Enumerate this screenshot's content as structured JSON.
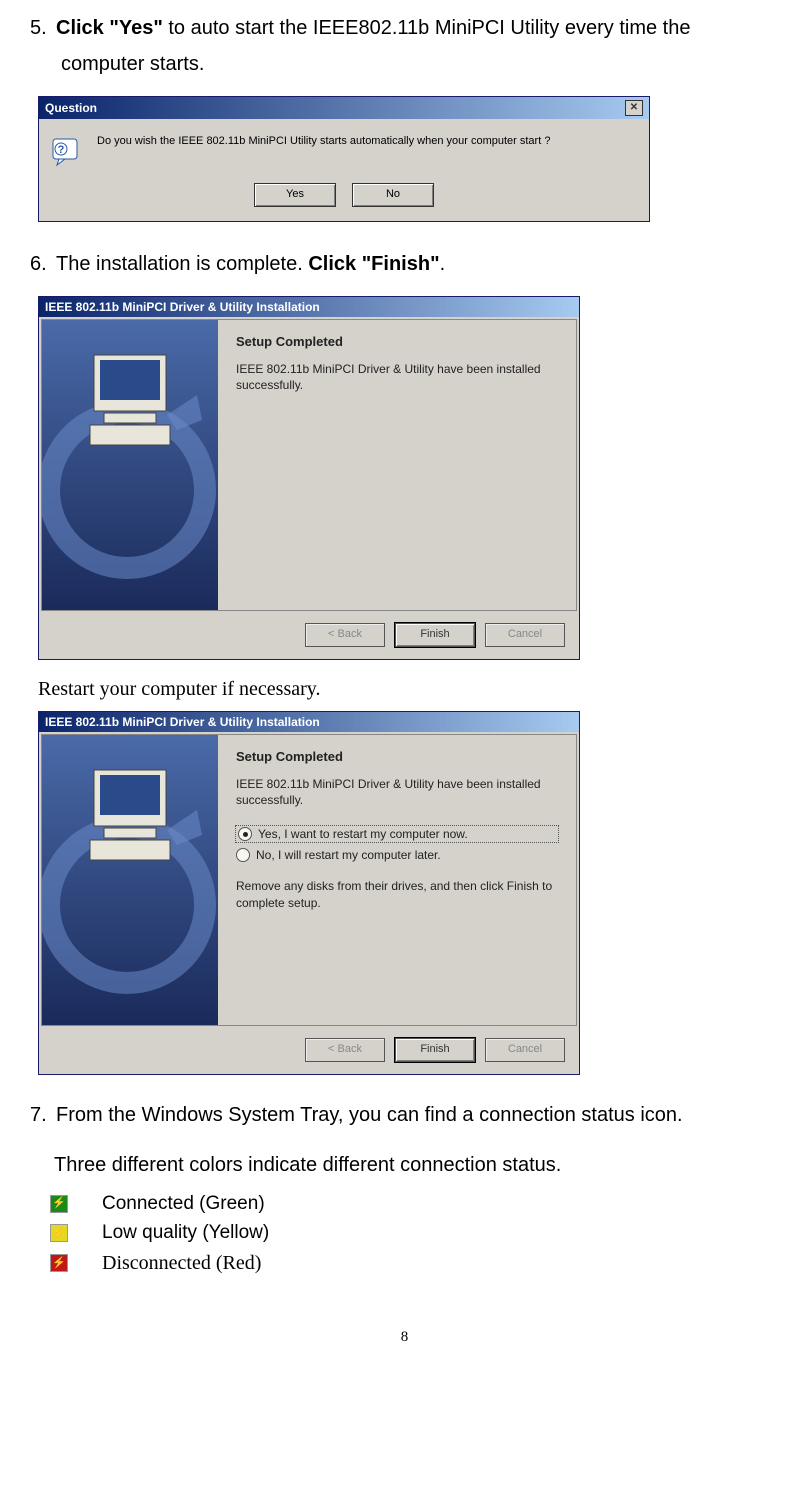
{
  "step5": {
    "num": "5.",
    "bold": "Click \"Yes\"",
    "rest": " to auto start the IEEE802.11b MiniPCI Utility every time the",
    "line2": "computer starts."
  },
  "dlg_question": {
    "title": "Question",
    "message": "Do you wish the IEEE 802.11b MiniPCI Utility starts automatically when your computer start ?",
    "yes": "Yes",
    "no": "No"
  },
  "step6": {
    "num": "6.",
    "text": "The installation is complete.  ",
    "bold": "Click \"Finish\"",
    "period": "."
  },
  "dlg_wizard1": {
    "title": "IEEE 802.11b MiniPCI Driver & Utility Installation",
    "heading": "Setup Completed",
    "msg": "IEEE 802.11b MiniPCI Driver & Utility have been installed successfully.",
    "back": "< Back",
    "finish": "Finish",
    "cancel": "Cancel"
  },
  "restart_note": "Restart your computer if necessary.",
  "dlg_wizard2": {
    "title": "IEEE 802.11b MiniPCI Driver & Utility Installation",
    "heading": "Setup Completed",
    "msg": "IEEE 802.11b MiniPCI Driver & Utility have been installed successfully.",
    "opt1": "Yes, I want to restart my computer now.",
    "opt2": "No, I will restart my computer later.",
    "msg2": "Remove any disks from their drives, and then click Finish to complete setup.",
    "back": "< Back",
    "finish": "Finish",
    "cancel": "Cancel"
  },
  "step7": {
    "num": "7.",
    "text": "From the Windows System Tray, you can find a connection status icon.",
    "sub": "Three different colors indicate different connection status."
  },
  "status": {
    "green": "Connected (Green)",
    "yellow": "Low quality (Yellow)",
    "red": "Disconnected (Red)"
  },
  "page_num": "8"
}
